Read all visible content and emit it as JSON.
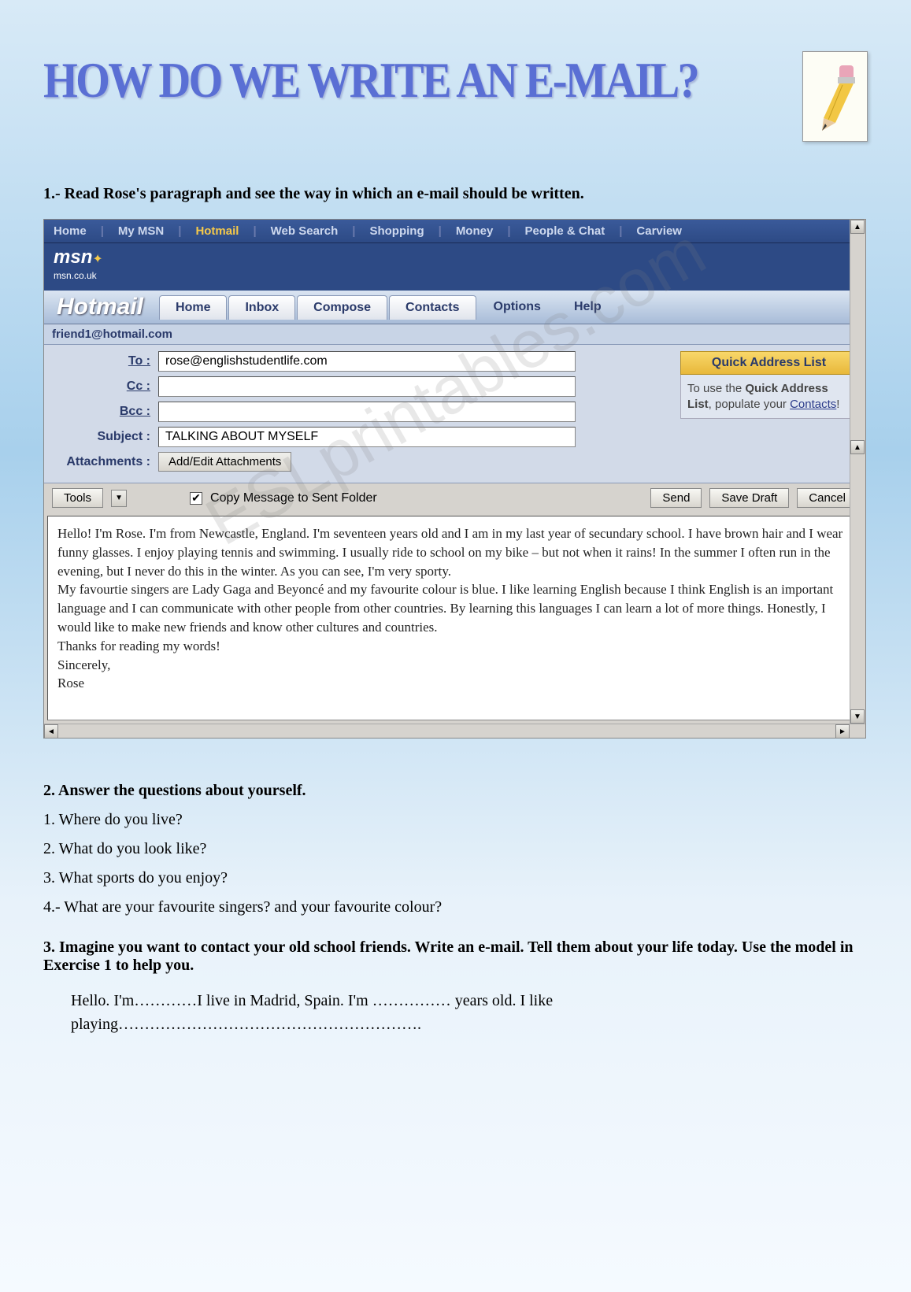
{
  "watermark": "ESLprintables.com",
  "title": "HOW DO WE WRITE AN E-MAIL?",
  "instruction1": "1.- Read Rose's paragraph and see the way in which an e-mail should be written.",
  "msn_nav": {
    "home": "Home",
    "mymsn": "My MSN",
    "hotmail": "Hotmail",
    "websearch": "Web Search",
    "shopping": "Shopping",
    "money": "Money",
    "people": "People & Chat",
    "carview": "Carview"
  },
  "msn_logo": {
    "big": "msn",
    "small": "msn.co.uk"
  },
  "hotmail_logo": "Hotmail",
  "tabs": {
    "home": "Home",
    "inbox": "Inbox",
    "compose": "Compose",
    "contacts": "Contacts",
    "options": "Options",
    "help": "Help"
  },
  "user_email": "friend1@hotmail.com",
  "fields": {
    "to_label": "To :",
    "to_value": "rose@englishstudentlife.com",
    "cc_label": "Cc :",
    "cc_value": "",
    "bcc_label": "Bcc :",
    "bcc_value": "",
    "subject_label": "Subject :",
    "subject_value": "TALKING ABOUT MYSELF",
    "attachments_label": "Attachments :",
    "attachments_btn": "Add/Edit Attachments"
  },
  "quick_address": {
    "header": "Quick Address List",
    "body_pre": "To use the ",
    "body_bold": "Quick Address List",
    "body_mid": ", populate your ",
    "body_link": "Contacts",
    "body_post": "!"
  },
  "toolbar": {
    "tools": "Tools",
    "copy_msg": "Copy Message to Sent Folder",
    "send": "Send",
    "save_draft": "Save Draft",
    "cancel": "Cancel"
  },
  "message": {
    "p1": "Hello! I'm Rose. I'm from Newcastle, England. I'm seventeen years old and I am in my last year of secundary school. I have brown hair and I wear funny glasses. I enjoy playing tennis and swimming. I usually ride to school on my bike – but not when it rains! In the summer I often run in the evening, but I never do this in the winter. As you can see, I'm very sporty.",
    "p2": "My favourtie singers are Lady Gaga and Beyoncé and my favourite colour is blue. I like learning English because I think English is an important language and I can communicate with other people from other countries. By learning this languages I can learn a lot of more things. Honestly, I would like to make new friends and know other cultures and countries.",
    "p3": "Thanks for reading my words!",
    "p4": "Sincerely,",
    "p5": "Rose"
  },
  "section2": {
    "heading": "2. Answer the questions about yourself.",
    "q1": "1. Where do you live?",
    "q2": "2. What do you look like?",
    "q3": "3. What sports do you enjoy?",
    "q4": "4.- What are your favourite singers? and your favourite colour?"
  },
  "section3": {
    "heading": "3. Imagine you want to contact your old school friends. Write an e-mail. Tell them about your life today. Use the model in Exercise 1 to help you.",
    "body": "Hello. I'm…………I live in Madrid, Spain. I'm …………… years old. I like playing…………………………………………………."
  }
}
